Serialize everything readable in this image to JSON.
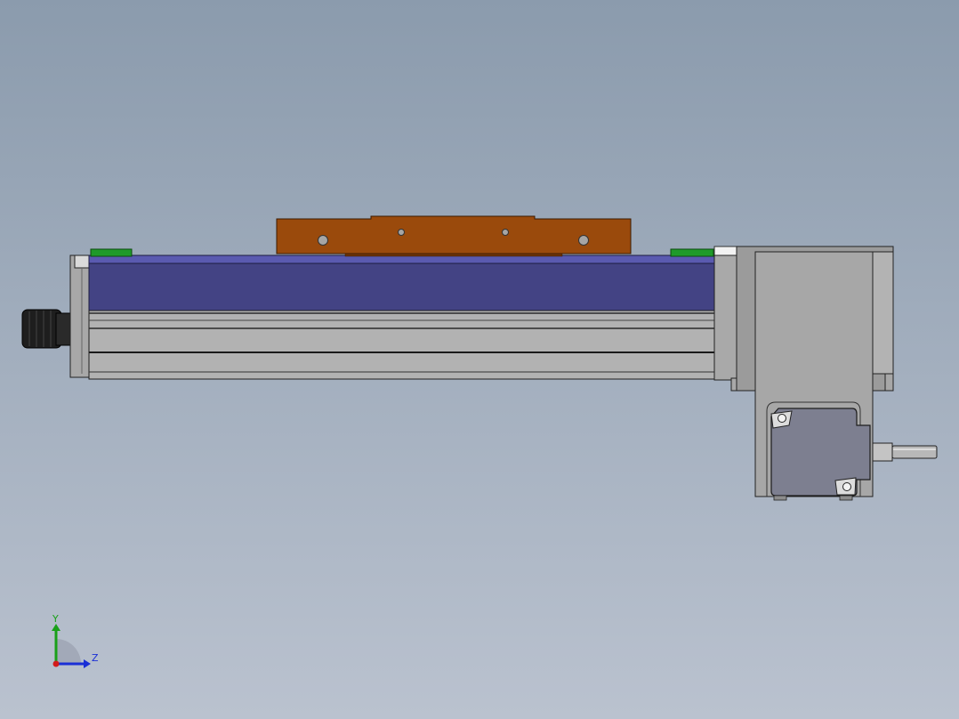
{
  "viewport": {
    "background_top": "#8b9bad",
    "background_bottom": "#bac2cf"
  },
  "colors": {
    "carriage": "#9a4a0c",
    "cover": "#434384",
    "aluminum": "#b2b2b2",
    "stop_pad": "#1f9a2a",
    "dark": "#1a1a1a"
  },
  "triad": {
    "y_label": "Y",
    "z_label": "Z",
    "y_color": "#19a019",
    "z_color": "#1a2fd6",
    "x_color": "#d21a1a"
  }
}
